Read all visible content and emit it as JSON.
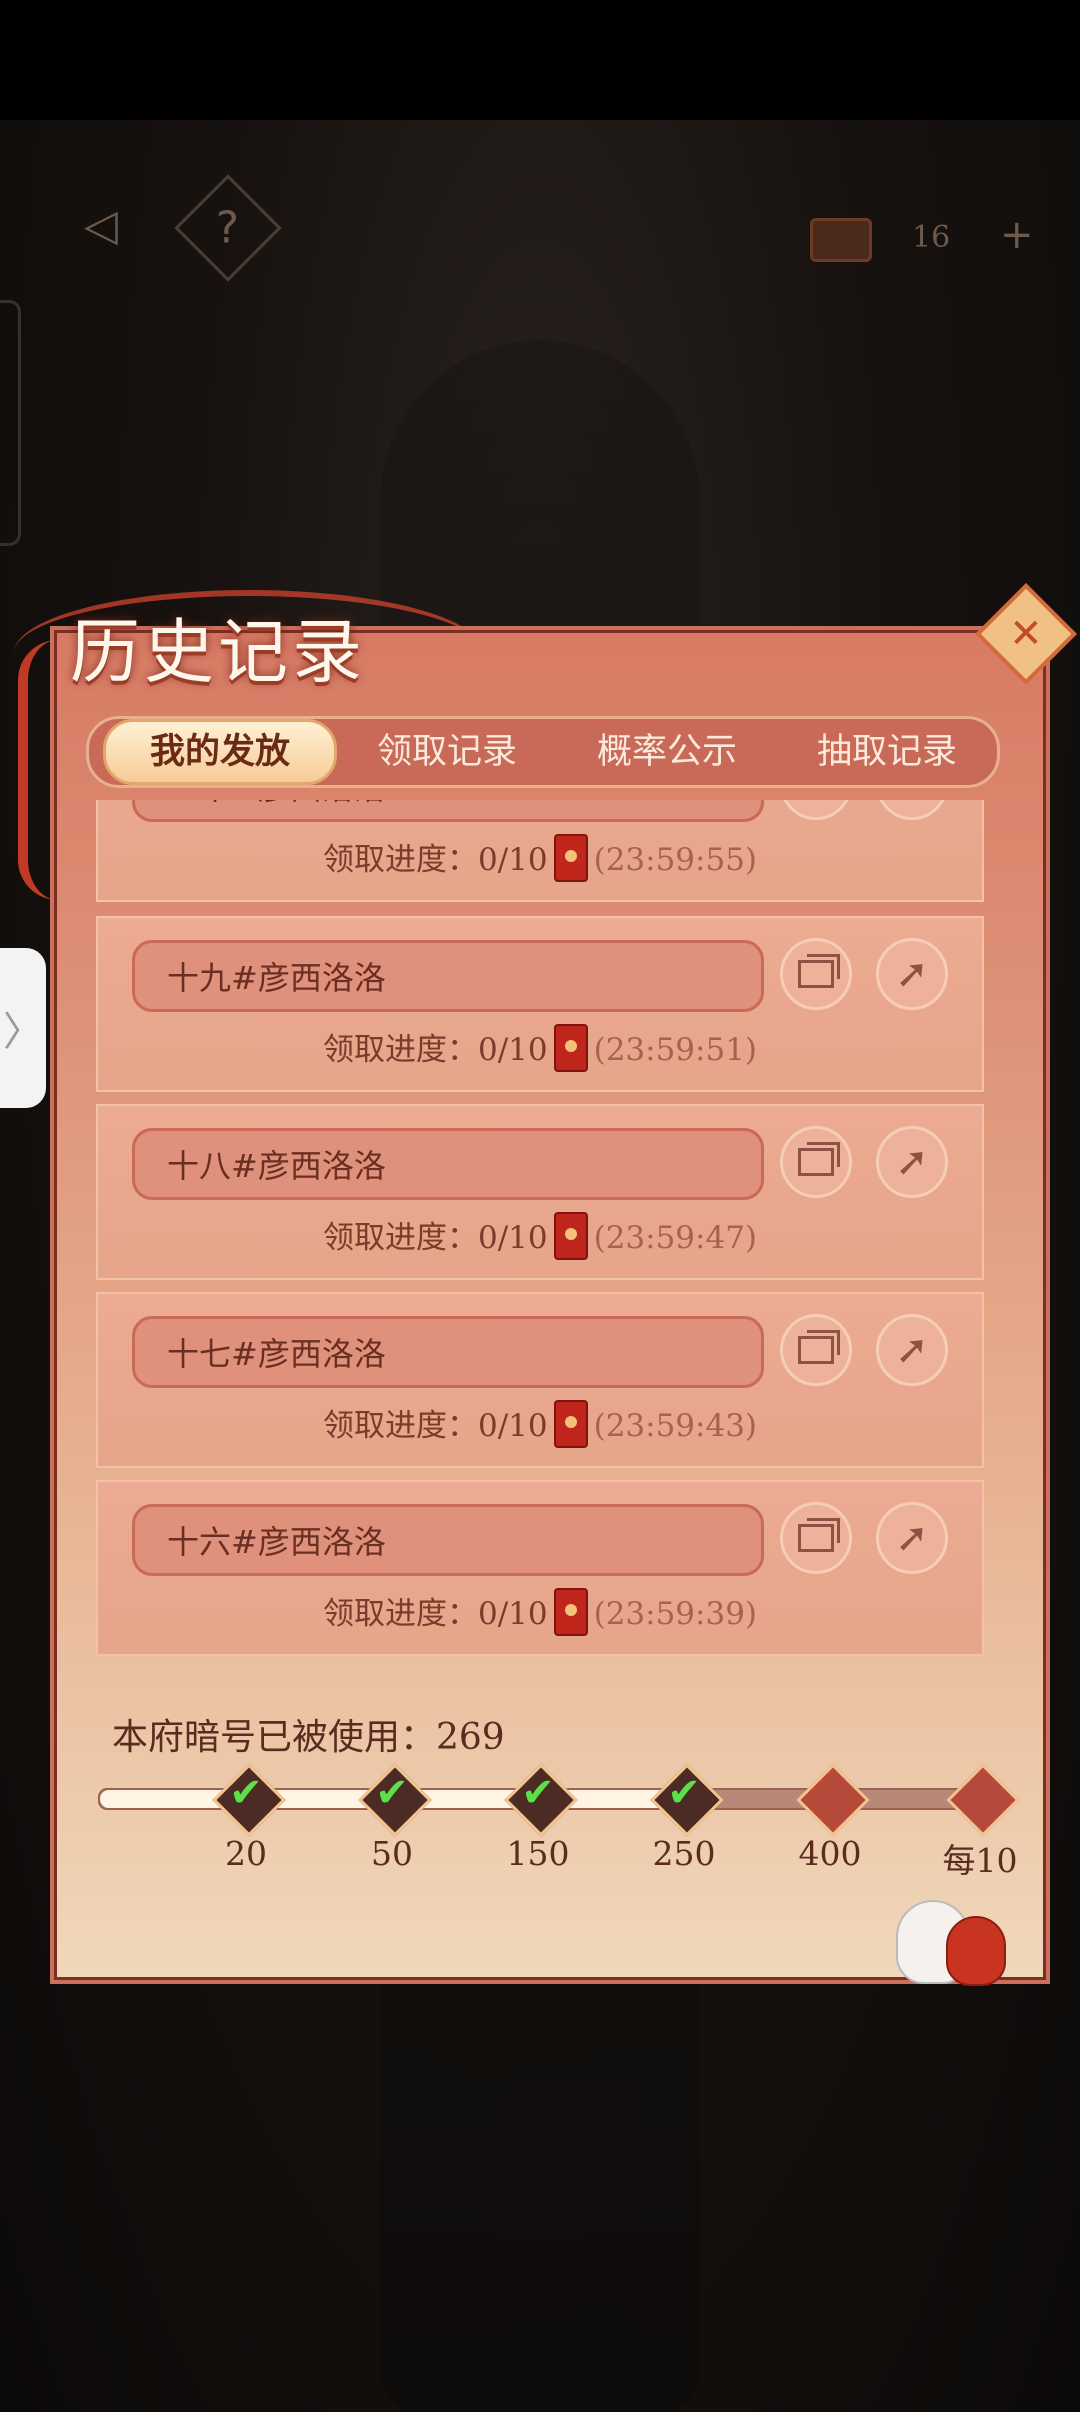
{
  "hud": {
    "back_icon": "back-arrow-icon",
    "help_label": "?",
    "token_count": "16",
    "plus_label": "+",
    "expand_label": "〉"
  },
  "modal": {
    "title": "历史记录",
    "close_icon": "close-icon",
    "tabs": [
      {
        "label": "我的发放",
        "active": true
      },
      {
        "label": "领取记录",
        "active": false
      },
      {
        "label": "概率公示",
        "active": false
      },
      {
        "label": "抽取记录",
        "active": false
      }
    ],
    "progress_prefix": "领取进度：",
    "records": [
      {
        "name": "二十#彦西洛洛",
        "progress": "0/10",
        "time": "(23:59:55)"
      },
      {
        "name": "十九#彦西洛洛",
        "progress": "0/10",
        "time": "(23:59:51)"
      },
      {
        "name": "十八#彦西洛洛",
        "progress": "0/10",
        "time": "(23:59:47)"
      },
      {
        "name": "十七#彦西洛洛",
        "progress": "0/10",
        "time": "(23:59:43)"
      },
      {
        "name": "十六#彦西洛洛",
        "progress": "0/10",
        "time": "(23:59:39)"
      }
    ],
    "usage_label": "本府暗号已被使用：269",
    "usage_count": 269,
    "milestones": [
      {
        "label": "20",
        "reached": true
      },
      {
        "label": "50",
        "reached": true
      },
      {
        "label": "150",
        "reached": true
      },
      {
        "label": "250",
        "reached": true
      },
      {
        "label": "400",
        "reached": false
      },
      {
        "label": "每10",
        "reached": false
      }
    ],
    "track_progress": 0.66,
    "check_glyph": "✔"
  }
}
